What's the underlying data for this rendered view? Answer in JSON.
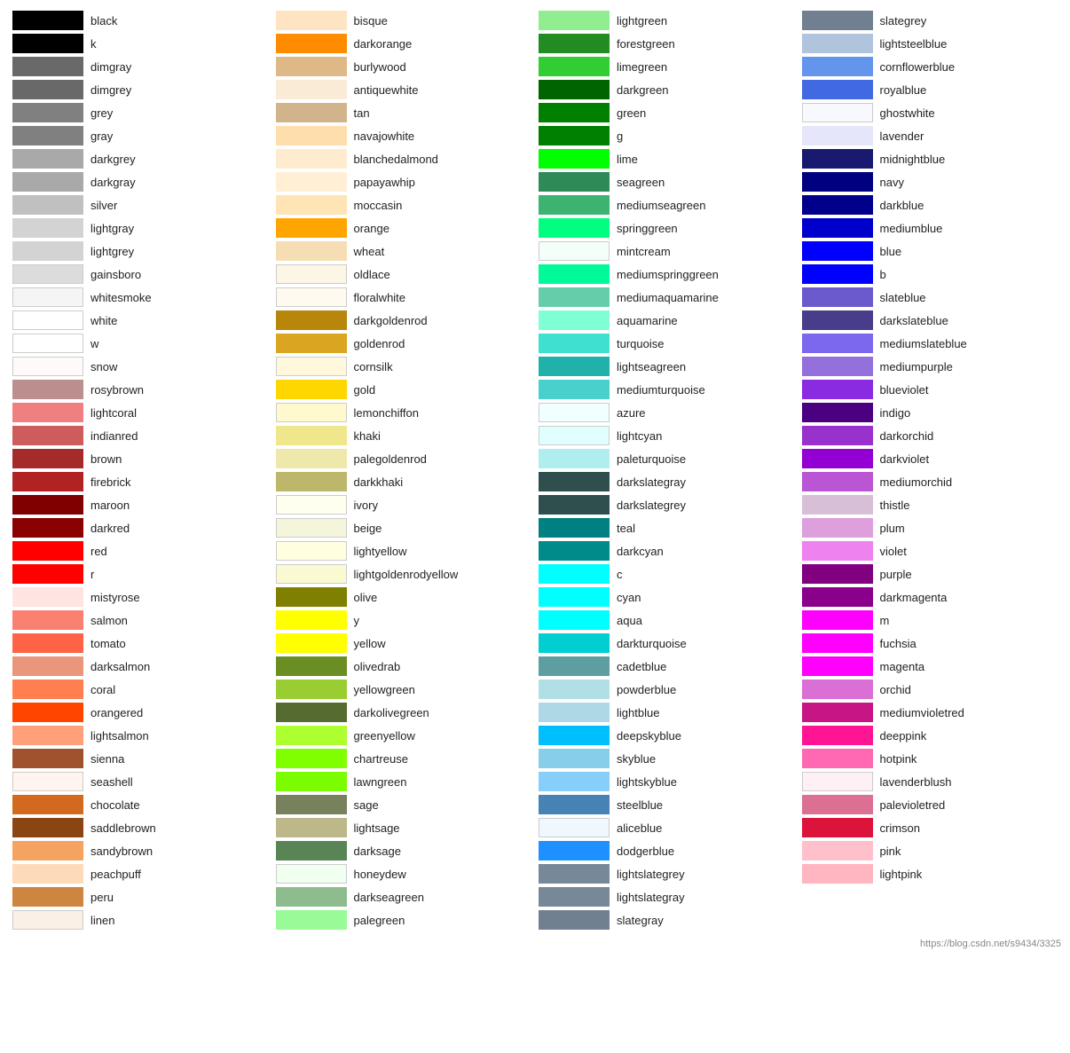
{
  "columns": [
    {
      "id": "col1",
      "items": [
        {
          "name": "black",
          "color": "#000000"
        },
        {
          "name": "k",
          "color": "#000000"
        },
        {
          "name": "dimgray",
          "color": "#696969"
        },
        {
          "name": "dimgrey",
          "color": "#696969"
        },
        {
          "name": "grey",
          "color": "#808080"
        },
        {
          "name": "gray",
          "color": "#808080"
        },
        {
          "name": "darkgrey",
          "color": "#a9a9a9"
        },
        {
          "name": "darkgray",
          "color": "#a9a9a9"
        },
        {
          "name": "silver",
          "color": "#c0c0c0"
        },
        {
          "name": "lightgray",
          "color": "#d3d3d3"
        },
        {
          "name": "lightgrey",
          "color": "#d3d3d3"
        },
        {
          "name": "gainsboro",
          "color": "#dcdcdc"
        },
        {
          "name": "whitesmoke",
          "color": "#f5f5f5"
        },
        {
          "name": "white",
          "color": "#ffffff"
        },
        {
          "name": "w",
          "color": "#ffffff"
        },
        {
          "name": "snow",
          "color": "#fffafa"
        },
        {
          "name": "rosybrown",
          "color": "#bc8f8f"
        },
        {
          "name": "lightcoral",
          "color": "#f08080"
        },
        {
          "name": "indianred",
          "color": "#cd5c5c"
        },
        {
          "name": "brown",
          "color": "#a52a2a"
        },
        {
          "name": "firebrick",
          "color": "#b22222"
        },
        {
          "name": "maroon",
          "color": "#800000"
        },
        {
          "name": "darkred",
          "color": "#8b0000"
        },
        {
          "name": "red",
          "color": "#ff0000"
        },
        {
          "name": "r",
          "color": "#ff0000"
        },
        {
          "name": "mistyrose",
          "color": "#ffe4e1"
        },
        {
          "name": "salmon",
          "color": "#fa8072"
        },
        {
          "name": "tomato",
          "color": "#ff6347"
        },
        {
          "name": "darksalmon",
          "color": "#e9967a"
        },
        {
          "name": "coral",
          "color": "#ff7f50"
        },
        {
          "name": "orangered",
          "color": "#ff4500"
        },
        {
          "name": "lightsalmon",
          "color": "#ffa07a"
        },
        {
          "name": "sienna",
          "color": "#a0522d"
        },
        {
          "name": "seashell",
          "color": "#fff5ee"
        },
        {
          "name": "chocolate",
          "color": "#d2691e"
        },
        {
          "name": "saddlebrown",
          "color": "#8b4513"
        },
        {
          "name": "sandybrown",
          "color": "#f4a460"
        },
        {
          "name": "peachpuff",
          "color": "#ffdab9"
        },
        {
          "name": "peru",
          "color": "#cd853f"
        },
        {
          "name": "linen",
          "color": "#faf0e6"
        }
      ]
    },
    {
      "id": "col2",
      "items": [
        {
          "name": "bisque",
          "color": "#ffe4c4"
        },
        {
          "name": "darkorange",
          "color": "#ff8c00"
        },
        {
          "name": "burlywood",
          "color": "#deb887"
        },
        {
          "name": "antiquewhite",
          "color": "#faebd7"
        },
        {
          "name": "tan",
          "color": "#d2b48c"
        },
        {
          "name": "navajowhite",
          "color": "#ffdead"
        },
        {
          "name": "blanchedalmond",
          "color": "#ffebcd"
        },
        {
          "name": "papayawhip",
          "color": "#ffefd5"
        },
        {
          "name": "moccasin",
          "color": "#ffe4b5"
        },
        {
          "name": "orange",
          "color": "#ffa500"
        },
        {
          "name": "wheat",
          "color": "#f5deb3"
        },
        {
          "name": "oldlace",
          "color": "#fdf5e6"
        },
        {
          "name": "floralwhite",
          "color": "#fffaf0"
        },
        {
          "name": "darkgoldenrod",
          "color": "#b8860b"
        },
        {
          "name": "goldenrod",
          "color": "#daa520"
        },
        {
          "name": "cornsilk",
          "color": "#fff8dc"
        },
        {
          "name": "gold",
          "color": "#ffd700"
        },
        {
          "name": "lemonchiffon",
          "color": "#fffacd"
        },
        {
          "name": "khaki",
          "color": "#f0e68c"
        },
        {
          "name": "palegoldenrod",
          "color": "#eee8aa"
        },
        {
          "name": "darkkhaki",
          "color": "#bdb76b"
        },
        {
          "name": "ivory",
          "color": "#fffff0"
        },
        {
          "name": "beige",
          "color": "#f5f5dc"
        },
        {
          "name": "lightyellow",
          "color": "#ffffe0"
        },
        {
          "name": "lightgoldenrodyellow",
          "color": "#fafad2"
        },
        {
          "name": "olive",
          "color": "#808000"
        },
        {
          "name": "y",
          "color": "#ffff00"
        },
        {
          "name": "yellow",
          "color": "#ffff00"
        },
        {
          "name": "olivedrab",
          "color": "#6b8e23"
        },
        {
          "name": "yellowgreen",
          "color": "#9acd32"
        },
        {
          "name": "darkolivegreen",
          "color": "#556b2f"
        },
        {
          "name": "greenyellow",
          "color": "#adff2f"
        },
        {
          "name": "chartreuse",
          "color": "#7fff00"
        },
        {
          "name": "lawngreen",
          "color": "#7cfc00"
        },
        {
          "name": "sage",
          "color": "#77815c"
        },
        {
          "name": "lightsage",
          "color": "#bcb88a"
        },
        {
          "name": "darksage",
          "color": "#598556"
        },
        {
          "name": "honeydew",
          "color": "#f0fff0"
        },
        {
          "name": "darkseagreen",
          "color": "#8fbc8f"
        },
        {
          "name": "palegreen",
          "color": "#98fb98"
        }
      ]
    },
    {
      "id": "col3",
      "items": [
        {
          "name": "lightgreen",
          "color": "#90ee90"
        },
        {
          "name": "forestgreen",
          "color": "#228b22"
        },
        {
          "name": "limegreen",
          "color": "#32cd32"
        },
        {
          "name": "darkgreen",
          "color": "#006400"
        },
        {
          "name": "green",
          "color": "#008000"
        },
        {
          "name": "g",
          "color": "#008000"
        },
        {
          "name": "lime",
          "color": "#00ff00"
        },
        {
          "name": "seagreen",
          "color": "#2e8b57"
        },
        {
          "name": "mediumseagreen",
          "color": "#3cb371"
        },
        {
          "name": "springgreen",
          "color": "#00ff7f"
        },
        {
          "name": "mintcream",
          "color": "#f5fffa"
        },
        {
          "name": "mediumspringgreen",
          "color": "#00fa9a"
        },
        {
          "name": "mediumaquamarine",
          "color": "#66cdaa"
        },
        {
          "name": "aquamarine",
          "color": "#7fffd4"
        },
        {
          "name": "turquoise",
          "color": "#40e0d0"
        },
        {
          "name": "lightseagreen",
          "color": "#20b2aa"
        },
        {
          "name": "mediumturquoise",
          "color": "#48d1cc"
        },
        {
          "name": "azure",
          "color": "#f0ffff"
        },
        {
          "name": "lightcyan",
          "color": "#e0ffff"
        },
        {
          "name": "paleturquoise",
          "color": "#afeeee"
        },
        {
          "name": "darkslategray",
          "color": "#2f4f4f"
        },
        {
          "name": "darkslategrey",
          "color": "#2f4f4f"
        },
        {
          "name": "teal",
          "color": "#008080"
        },
        {
          "name": "darkcyan",
          "color": "#008b8b"
        },
        {
          "name": "c",
          "color": "#00ffff"
        },
        {
          "name": "cyan",
          "color": "#00ffff"
        },
        {
          "name": "aqua",
          "color": "#00ffff"
        },
        {
          "name": "darkturquoise",
          "color": "#00ced1"
        },
        {
          "name": "cadetblue",
          "color": "#5f9ea0"
        },
        {
          "name": "powderblue",
          "color": "#b0e0e6"
        },
        {
          "name": "lightblue",
          "color": "#add8e6"
        },
        {
          "name": "deepskyblue",
          "color": "#00bfff"
        },
        {
          "name": "skyblue",
          "color": "#87ceeb"
        },
        {
          "name": "lightskyblue",
          "color": "#87cefa"
        },
        {
          "name": "steelblue",
          "color": "#4682b4"
        },
        {
          "name": "aliceblue",
          "color": "#f0f8ff"
        },
        {
          "name": "dodgerblue",
          "color": "#1e90ff"
        },
        {
          "name": "lightslategrey",
          "color": "#778899"
        },
        {
          "name": "lightslategray",
          "color": "#778899"
        },
        {
          "name": "slategray",
          "color": "#708090"
        }
      ]
    },
    {
      "id": "col4",
      "items": [
        {
          "name": "slategrey",
          "color": "#708090"
        },
        {
          "name": "lightsteelblue",
          "color": "#b0c4de"
        },
        {
          "name": "cornflowerblue",
          "color": "#6495ed"
        },
        {
          "name": "royalblue",
          "color": "#4169e1"
        },
        {
          "name": "ghostwhite",
          "color": "#f8f8ff"
        },
        {
          "name": "lavender",
          "color": "#e6e6fa"
        },
        {
          "name": "midnightblue",
          "color": "#191970"
        },
        {
          "name": "navy",
          "color": "#000080"
        },
        {
          "name": "darkblue",
          "color": "#00008b"
        },
        {
          "name": "mediumblue",
          "color": "#0000cd"
        },
        {
          "name": "blue",
          "color": "#0000ff"
        },
        {
          "name": "b",
          "color": "#0000ff"
        },
        {
          "name": "slateblue",
          "color": "#6a5acd"
        },
        {
          "name": "darkslateblue",
          "color": "#483d8b"
        },
        {
          "name": "mediumslateblue",
          "color": "#7b68ee"
        },
        {
          "name": "mediumpurple",
          "color": "#9370db"
        },
        {
          "name": "blueviolet",
          "color": "#8a2be2"
        },
        {
          "name": "indigo",
          "color": "#4b0082"
        },
        {
          "name": "darkorchid",
          "color": "#9932cc"
        },
        {
          "name": "darkviolet",
          "color": "#9400d3"
        },
        {
          "name": "mediumorchid",
          "color": "#ba55d3"
        },
        {
          "name": "thistle",
          "color": "#d8bfd8"
        },
        {
          "name": "plum",
          "color": "#dda0dd"
        },
        {
          "name": "violet",
          "color": "#ee82ee"
        },
        {
          "name": "purple",
          "color": "#800080"
        },
        {
          "name": "darkmagenta",
          "color": "#8b008b"
        },
        {
          "name": "m",
          "color": "#ff00ff"
        },
        {
          "name": "fuchsia",
          "color": "#ff00ff"
        },
        {
          "name": "magenta",
          "color": "#ff00ff"
        },
        {
          "name": "orchid",
          "color": "#da70d6"
        },
        {
          "name": "mediumvioletred",
          "color": "#c71585"
        },
        {
          "name": "deeppink",
          "color": "#ff1493"
        },
        {
          "name": "hotpink",
          "color": "#ff69b4"
        },
        {
          "name": "lavenderblush",
          "color": "#fff0f5"
        },
        {
          "name": "palevioletred",
          "color": "#db7093"
        },
        {
          "name": "crimson",
          "color": "#dc143c"
        },
        {
          "name": "pink",
          "color": "#ffc0cb"
        },
        {
          "name": "lightpink",
          "color": "#ffb6c1"
        }
      ]
    }
  ],
  "footer": "https://blog.csdn.net/s9434/3325"
}
